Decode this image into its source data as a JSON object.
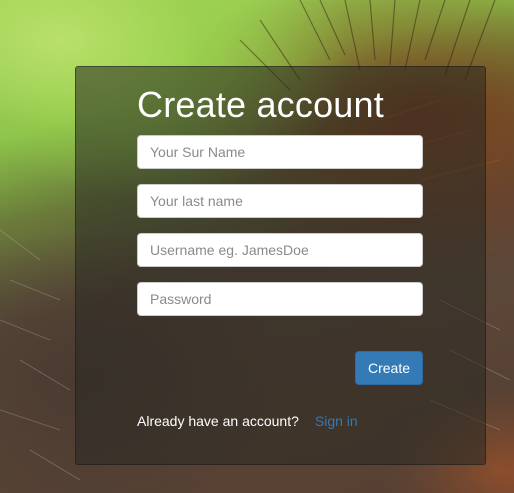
{
  "form": {
    "title": "Create account",
    "fields": [
      {
        "placeholder": "Your Sur Name",
        "value": ""
      },
      {
        "placeholder": "Your last name",
        "value": ""
      },
      {
        "placeholder": "Username eg. JamesDoe",
        "value": ""
      },
      {
        "placeholder": "Password",
        "value": ""
      }
    ],
    "create_label": "Create",
    "prompt_text": "Already have an account?",
    "signin_label": "Sign in"
  },
  "colors": {
    "accent": "#337ab7",
    "panel_overlay": "rgba(40,40,35,0.55)"
  }
}
